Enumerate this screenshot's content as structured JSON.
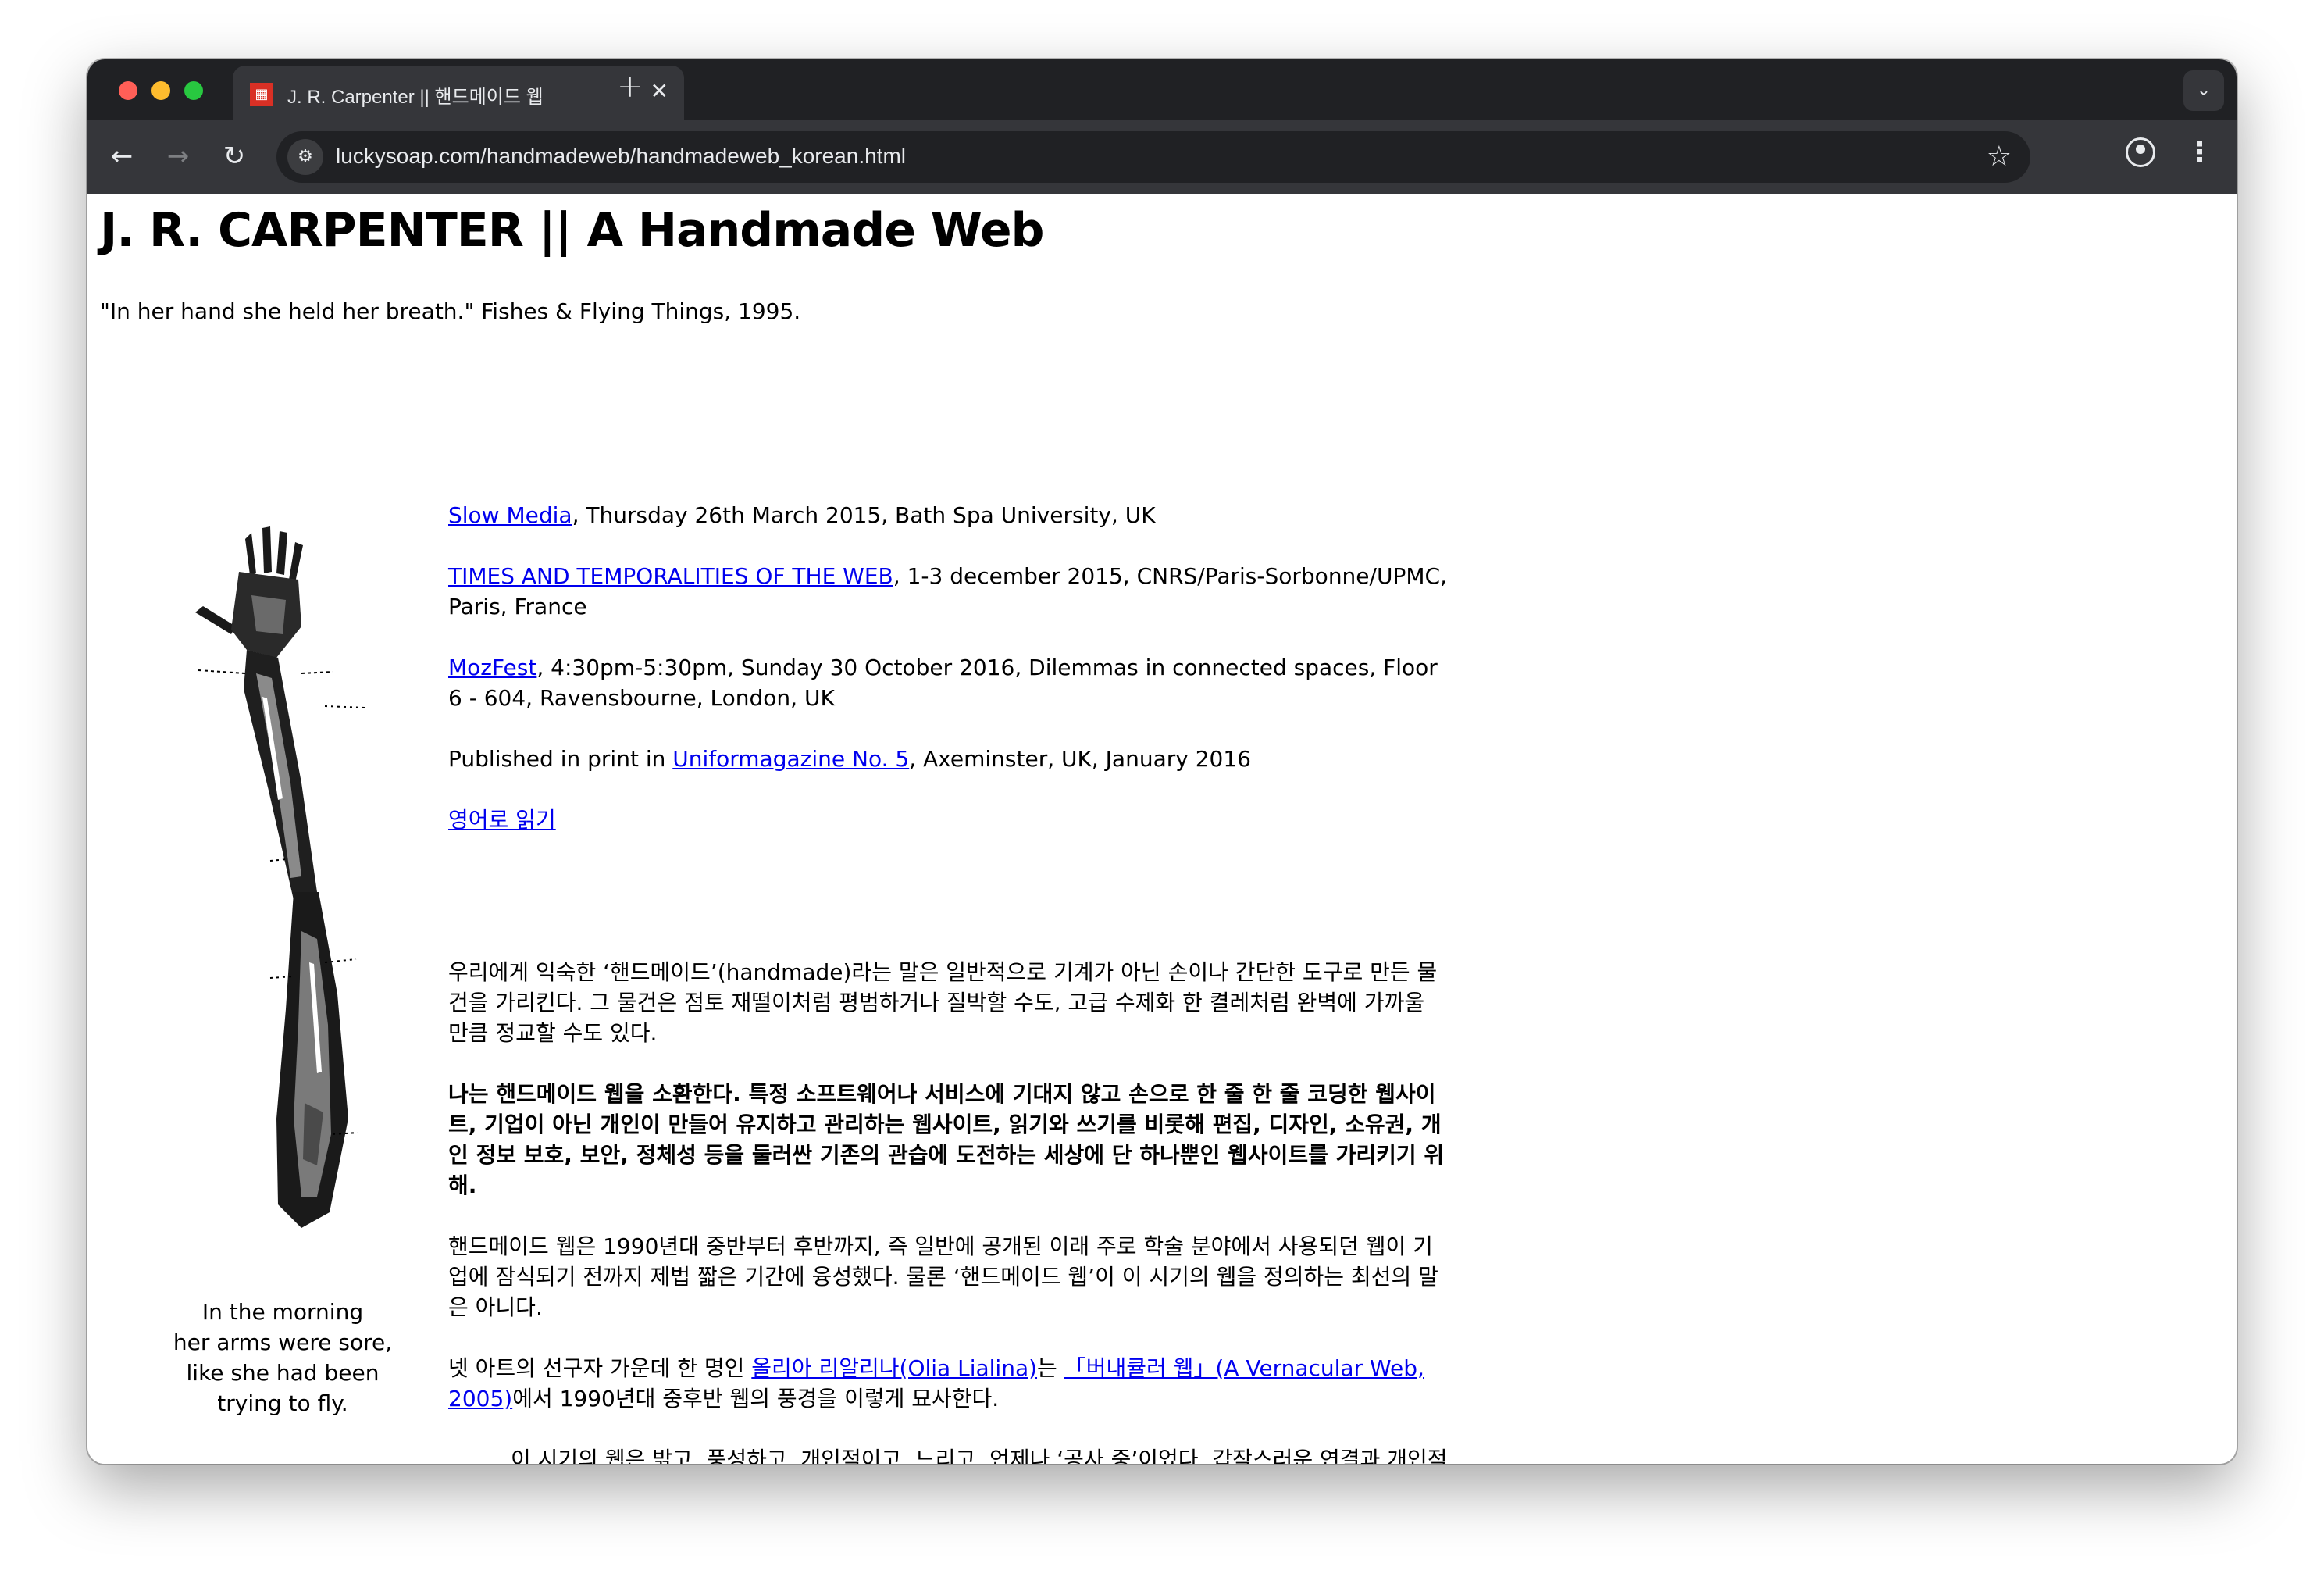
{
  "browser": {
    "tab_title": "J. R. Carpenter || 핸드메이드 웹",
    "tab_close": "✕",
    "new_tab": "+",
    "url": "luckysoap.com/handmadeweb/handmadeweb_korean.html",
    "icons": {
      "back": "←",
      "forward": "→",
      "reload": "↻",
      "star": "☆",
      "menu": "⋮",
      "tab_menu": "⌄",
      "site_info": "⚙"
    },
    "colors": {
      "tab_strip": "#202124",
      "toolbar": "#35363a",
      "omnibox": "#202124"
    }
  },
  "page": {
    "title": "J. R. CARPENTER || A Handmade Web",
    "epigraph": "\"In her hand she held her breath.\" Fishes & Flying Things, 1995.",
    "caption_lines": [
      "In the morning",
      "her arms were sore,",
      "like she had been",
      "trying to fly."
    ],
    "events": [
      {
        "link": "Slow Media",
        "text": ", Thursday 26th March 2015, Bath Spa University, UK"
      },
      {
        "link": "TIMES AND TEMPORALITIES OF THE WEB",
        "text": ", 1-3 december 2015, CNRS/Paris-Sorbonne/UPMC, Paris, France"
      },
      {
        "link": "MozFest",
        "text": ", 4:30pm-5:30pm, Sunday 30 October 2016, Dilemmas in connected spaces, Floor 6 - 604, Ravensbourne, London, UK"
      }
    ],
    "print": {
      "before": "Published in print in ",
      "link": "Uniformagazine No. 5",
      "after": ", Axeminster, UK, January 2016"
    },
    "read_english": "영어로 읽기",
    "paragraphs": {
      "p1": "우리에게 익숙한 ‘핸드메이드’(handmade)라는 말은 일반적으로 기계가 아닌 손이나 간단한 도구로 만든 물건을 가리킨다. 그 물건은 점토 재떨이처럼 평범하거나 질박할 수도, 고급 수제화 한 켤레처럼 완벽에 가까울 만큼 정교할 수도 있다.",
      "p2": "나는 핸드메이드 웹을 소환한다. 특정 소프트웨어나 서비스에 기대지 않고 손으로 한 줄 한 줄 코딩한 웹사이트, 기업이 아닌 개인이 만들어 유지하고 관리하는 웹사이트, 읽기와 쓰기를 비롯해 편집, 디자인, 소유권, 개인 정보 보호, 보안, 정체성 등을 둘러싼 기존의 관습에 도전하는 세상에 단 하나뿐인 웹사이트를 가리키기 위해.",
      "p3": "핸드메이드 웹은 1990년대 중반부터 후반까지, 즉 일반에 공개된 이래 주로 학술 분야에서 사용되던 웹이 기업에 잠식되기 전까지 제법 짧은 기간에 융성했다. 물론 ‘핸드메이드 웹’이 이 시기의 웹을 정의하는 최선의 말은 아니다.",
      "p4_before": "넷 아트의 선구자 가운데 한 명인 ",
      "p4_link1": "올리아 리알리나(Olia Lialina)",
      "p4_mid": "는 ",
      "p4_link2": "「버내큘러 웹」(A Vernacular Web, 2005)",
      "p4_after": "에서 1990년대 중후반 웹의 풍경을 이렇게 묘사한다.",
      "quote": "이 시기의 웹은 밝고, 풍성하고, 개인적이고, 느리고, 언제나 ‘공사 중’이었다. 갑작스러운 연결과 개인적인 연결이 이루어지기 더 빠른 속도와 더 강력한 컴퓨터로 향한 희망으로"
    }
  }
}
